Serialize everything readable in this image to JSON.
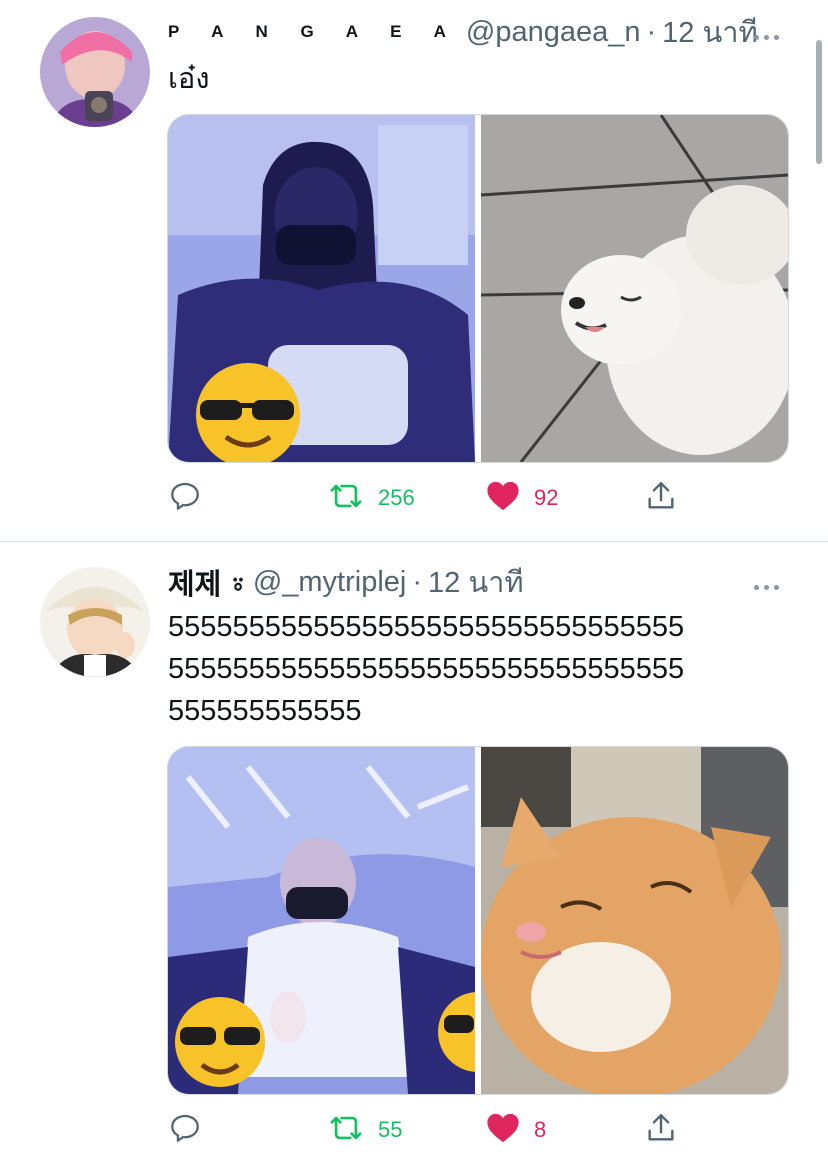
{
  "tweets": [
    {
      "display_name": "P A N G A E A",
      "handle": "@pangaea_n",
      "separator": "·",
      "time": "12 นาที",
      "text": "เอ๋ง",
      "retweet_count": "256",
      "like_count": "92"
    },
    {
      "display_name": "제제 ⍤",
      "handle": "@_mytriplej",
      "separator": "·",
      "time": "12 นาที",
      "text_lines": [
        "55555555555555555555555555555555",
        "55555555555555555555555555555555",
        "555555555555"
      ],
      "retweet_count": "55",
      "like_count": "8"
    }
  ],
  "icons": {
    "reply": "reply-icon",
    "retweet": "retweet-icon",
    "like": "heart-icon",
    "share": "share-icon",
    "more": "more-icon"
  },
  "colors": {
    "retweet": "#17bf63",
    "like": "#e0245e",
    "secondary_text": "#536471"
  }
}
